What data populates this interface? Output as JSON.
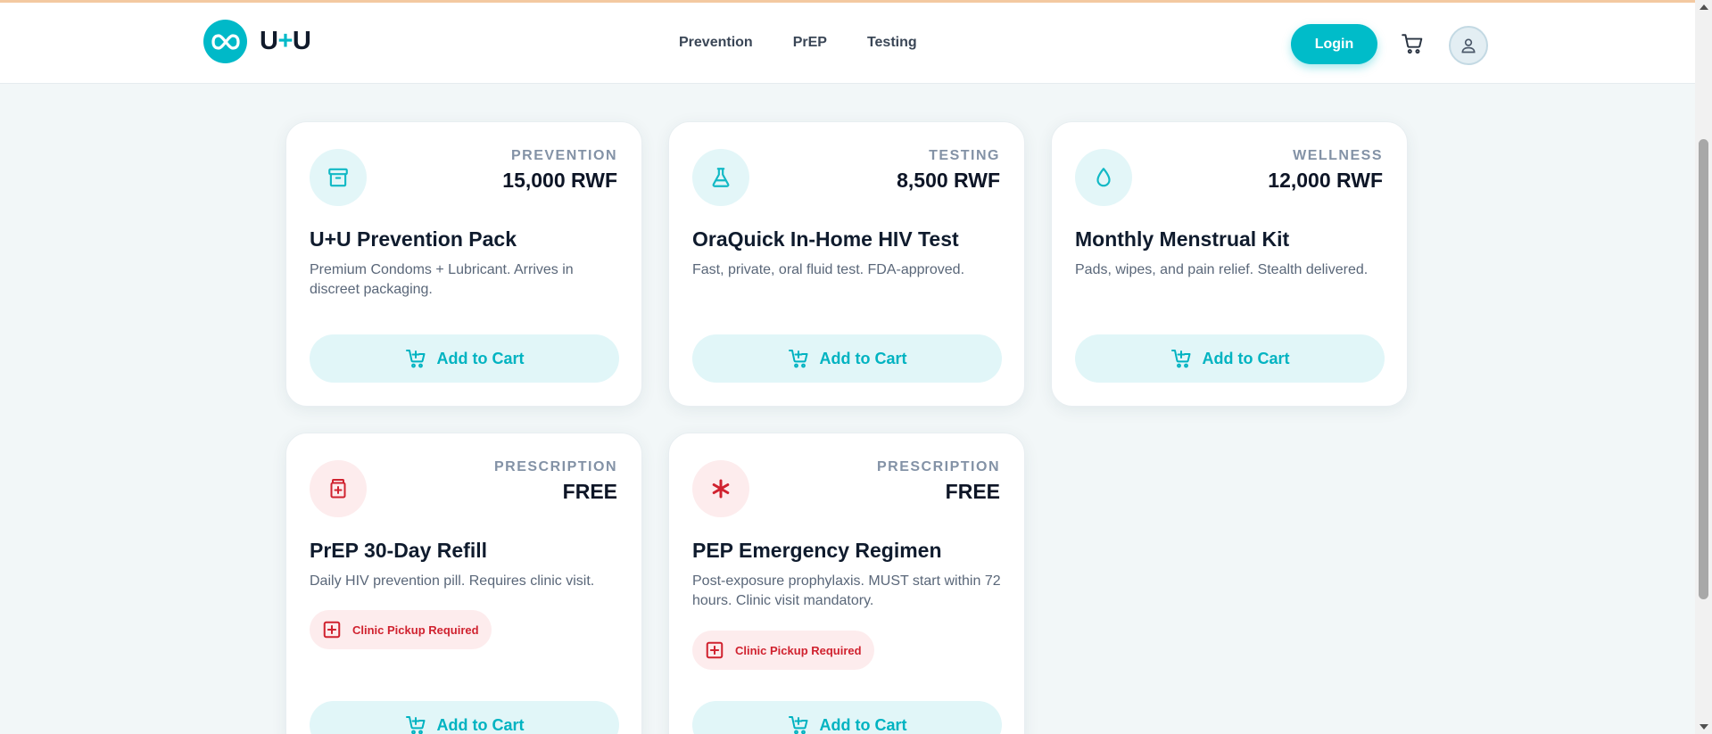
{
  "brand": {
    "name_prefix": "U",
    "name_plus": "+",
    "name_suffix": "U"
  },
  "nav": [
    {
      "label": "Prevention"
    },
    {
      "label": "PrEP"
    },
    {
      "label": "Testing"
    }
  ],
  "header": {
    "login_label": "Login",
    "cart_icon": "cart-icon",
    "avatar_icon": "user-icon"
  },
  "colors": {
    "accent": "#00bcc9",
    "warning": "#d0222f",
    "badge_bg": "#fdeced"
  },
  "products": [
    {
      "icon": "archive-box-icon",
      "category": "PREVENTION",
      "price": "15,000 RWF",
      "title": "U+U Prevention Pack",
      "description": "Premium Condoms + Lubricant. Arrives in discreet packaging.",
      "button_label": "Add to Cart"
    },
    {
      "icon": "flask-icon",
      "category": "TESTING",
      "price": "8,500 RWF",
      "title": "OraQuick In-Home HIV Test",
      "description": "Fast, private, oral fluid test. FDA-approved.",
      "button_label": "Add to Cart"
    },
    {
      "icon": "droplet-icon",
      "category": "WELLNESS",
      "price": "12,000 RWF",
      "title": "Monthly Menstrual Kit",
      "description": "Pads, wipes, and pain relief. Stealth delivered.",
      "button_label": "Add to Cart"
    },
    {
      "icon": "pill-bottle-icon",
      "category": "PRESCRIPTION",
      "price": "FREE",
      "title": "PrEP 30-Day Refill",
      "description": "Daily HIV prevention pill. Requires clinic visit.",
      "badge": "Clinic Pickup Required",
      "button_label": "Add to Cart"
    },
    {
      "icon": "asterisk-icon",
      "category": "PRESCRIPTION",
      "price": "FREE",
      "title": "PEP Emergency Regimen",
      "description": "Post-exposure prophylaxis. MUST start within 72 hours. Clinic visit mandatory.",
      "badge": "Clinic Pickup Required",
      "button_label": "Add to Cart"
    }
  ]
}
